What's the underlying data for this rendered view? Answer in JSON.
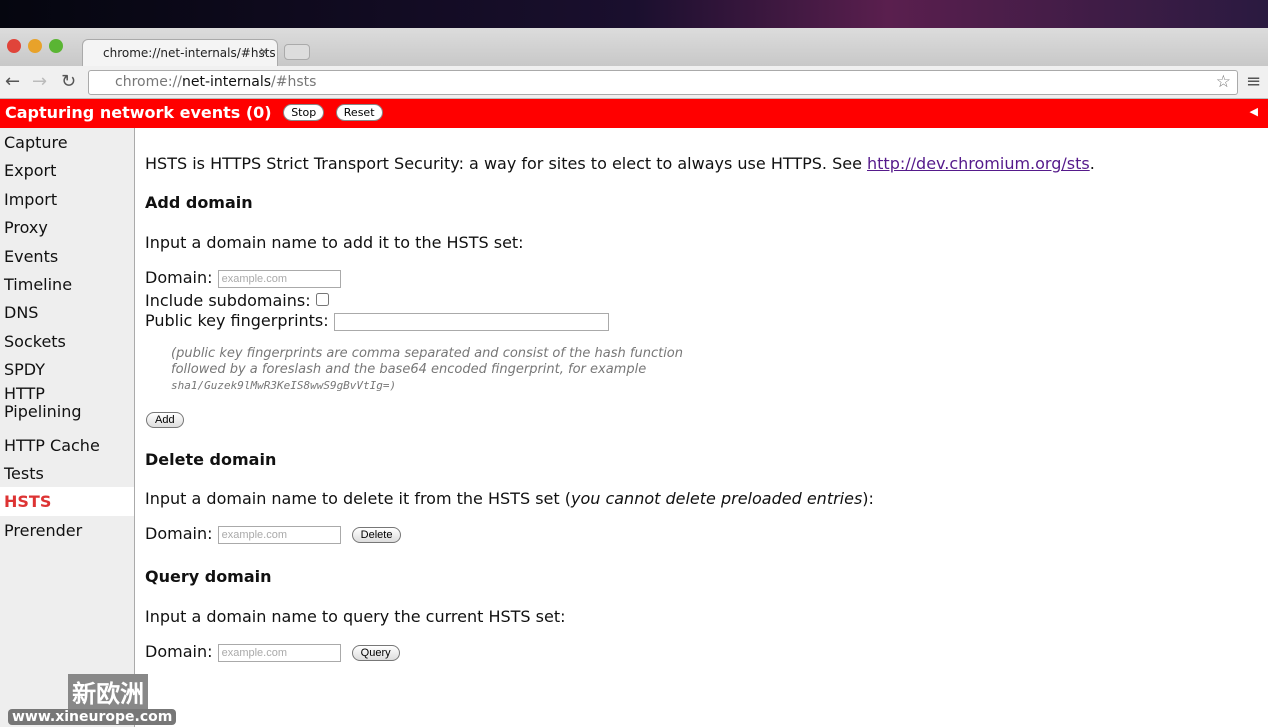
{
  "browser": {
    "tab_title": "chrome://net-internals/#hsts",
    "url_prefix": "chrome://",
    "url_host": "net-internals",
    "url_path": "/#hsts"
  },
  "capture": {
    "status": "Capturing network events (0)",
    "stop": "Stop",
    "reset": "Reset"
  },
  "sidebar": {
    "items": [
      "Capture",
      "Export",
      "Import",
      "Proxy",
      "Events",
      "Timeline",
      "DNS",
      "Sockets",
      "SPDY",
      "HTTP Pipelining",
      "HTTP Cache",
      "Tests",
      "HSTS",
      "Prerender"
    ],
    "active": "HSTS"
  },
  "main": {
    "intro": "HSTS is HTTPS Strict Transport Security: a way for sites to elect to always use HTTPS. See ",
    "intro_link": "http://dev.chromium.org/sts",
    "add": {
      "title": "Add domain",
      "desc": "Input a domain name to add it to the HSTS set:",
      "domain_label": "Domain:",
      "placeholder": "example.com",
      "subdomains_label": "Include subdomains:",
      "pins_label": "Public key fingerprints:",
      "note1": "(public key fingerprints are comma separated and consist of the hash function",
      "note2": "followed by a foreslash and the base64 encoded fingerprint, for example",
      "note3": "sha1/Guzek9lMwR3KeIS8wwS9gBvVtIg=)",
      "button": "Add"
    },
    "delete": {
      "title": "Delete domain",
      "desc_pre": "Input a domain name to delete it from the HSTS set (",
      "desc_em": "you cannot delete preloaded entries",
      "desc_post": "):",
      "domain_label": "Domain:",
      "placeholder": "example.com",
      "button": "Delete"
    },
    "query": {
      "title": "Query domain",
      "desc": "Input a domain name to query the current HSTS set:",
      "domain_label": "Domain:",
      "placeholder": "example.com",
      "button": "Query"
    }
  },
  "watermark": {
    "cn": "新欧洲",
    "url": "www.xineurope.com"
  }
}
